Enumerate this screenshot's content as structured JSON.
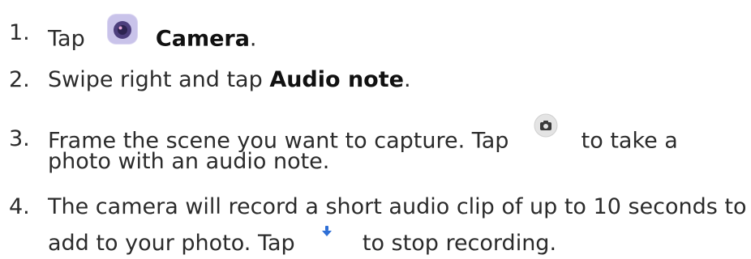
{
  "steps": [
    {
      "number": "1.",
      "pre": "Tap",
      "icon": "camera-app-icon",
      "bold": "Camera",
      "post": "."
    },
    {
      "number": "2.",
      "pre": "Swipe right and tap ",
      "bold": "Audio note",
      "post": "."
    },
    {
      "number": "3.",
      "pre": "Frame the scene you want to capture. Tap",
      "icon": "shutter-icon",
      "post": "to take a",
      "line2": "photo with an audio note."
    },
    {
      "number": "4.",
      "line1": "The camera will record a short audio clip of up to 10 seconds to",
      "line2_pre": "add to your photo. Tap",
      "icon": "stop-recording-icon",
      "line2_post": "to stop recording."
    }
  ],
  "colors": {
    "text": "#2b2b2b",
    "app_icon_outer": "#c9c3ea",
    "app_icon_lens": "#4d3f7d",
    "shutter_bg": "#e4e4e4",
    "stop_icon": "#2f6fd6"
  }
}
